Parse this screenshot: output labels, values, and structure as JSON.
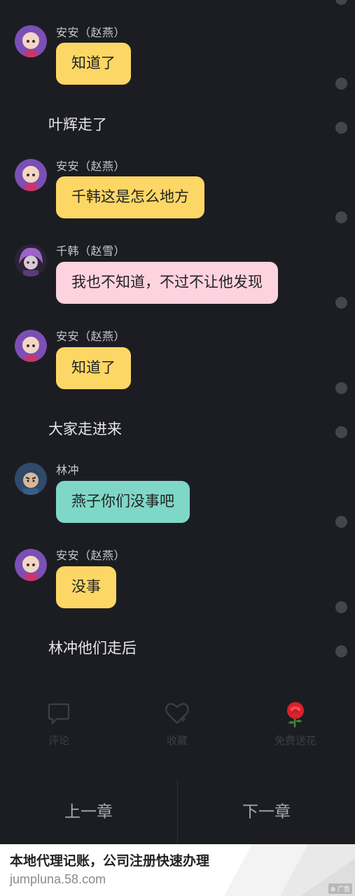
{
  "messages": [
    {
      "type": "bubble",
      "speaker": "安安（赵燕）",
      "text": "知道了",
      "color": "yellow",
      "avatar": "girl-avatar"
    },
    {
      "type": "narration",
      "text": "叶辉走了"
    },
    {
      "type": "bubble",
      "speaker": "安安（赵燕）",
      "text": "千韩这是怎么地方",
      "color": "yellow",
      "avatar": "girl-avatar"
    },
    {
      "type": "bubble",
      "speaker": "千韩（赵雪）",
      "text": "我也不知道，不过不让他发现",
      "color": "pink",
      "avatar": "purple-hair-avatar"
    },
    {
      "type": "bubble",
      "speaker": "安安（赵燕）",
      "text": "知道了",
      "color": "yellow",
      "avatar": "girl-avatar"
    },
    {
      "type": "narration",
      "text": "大家走进来"
    },
    {
      "type": "bubble",
      "speaker": "林冲",
      "text": "燕子你们没事吧",
      "color": "teal",
      "avatar": "boy-avatar"
    },
    {
      "type": "bubble",
      "speaker": "安安（赵燕）",
      "text": "没事",
      "color": "yellow",
      "avatar": "girl-avatar"
    },
    {
      "type": "narration",
      "text": "林冲他们走后"
    }
  ],
  "actions": {
    "comment": {
      "label": "评论",
      "icon": "comment-icon"
    },
    "favorite": {
      "label": "收藏",
      "icon": "heart-icon"
    },
    "flower": {
      "label": "免费送花",
      "icon": "rose-icon"
    }
  },
  "chapter_nav": {
    "prev": "上一章",
    "next": "下一章"
  },
  "ad": {
    "title": "本地代理记账，公司注册快速办理",
    "url": "jumpluna.58.com",
    "badge": "广告"
  },
  "colors": {
    "background": "#1c1d22",
    "yellow": "#fdd765",
    "pink": "#fcd3df",
    "teal": "#7fd7c7"
  }
}
